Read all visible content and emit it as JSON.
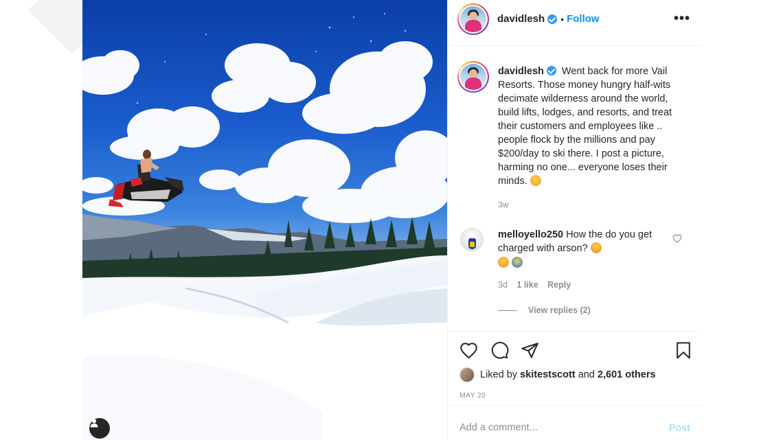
{
  "post": {
    "author": "davidlesh",
    "follow_label": "Follow",
    "caption": "Went back for more Vail Resorts. Those money hungry half-wits decimate wilderness around the world, build lifts, lodges, and resorts, and treat their customers and employees like          .. people flock by the millions and pay $200/day to ski there. I post a picture, harming no one... everyone loses their minds.",
    "caption_age": "3w"
  },
  "comment": {
    "author": "melloyello250",
    "text": "How the          do you get charged with arson?",
    "age": "3d",
    "likes": "1 like",
    "reply_label": "Reply",
    "view_replies": "View replies (2)"
  },
  "likes": {
    "prefix": "Liked by",
    "user": "skitestscott",
    "joiner": "and",
    "others": "2,601 others"
  },
  "post_date": "MAY 20",
  "add_comment": {
    "placeholder": "Add a comment...",
    "post_label": "Post"
  },
  "colors": {
    "accent": "#0095f6",
    "verified": "#3897f0",
    "muted": "#8e8e8e",
    "sky": "#1a5ccc"
  },
  "icons": [
    "more-options-icon",
    "verified-badge-icon",
    "heart-icon",
    "comment-icon",
    "share-icon",
    "bookmark-icon",
    "user-tag-icon"
  ]
}
